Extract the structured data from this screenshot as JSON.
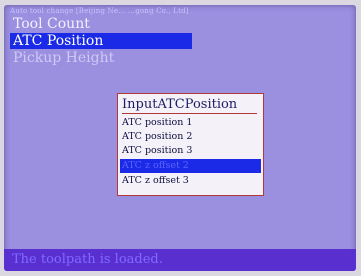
{
  "header": {
    "title": "Auto tool change [Beijing Ne... ...gong Co., Ltd]"
  },
  "menu": {
    "items": [
      {
        "label": "Tool Count",
        "selected": false
      },
      {
        "label": "ATC Position",
        "selected": true
      },
      {
        "label": "Pickup Height",
        "selected": false
      }
    ]
  },
  "popup": {
    "title": "InputATCPosition",
    "options": [
      {
        "label": "ATC position 1",
        "selected": false
      },
      {
        "label": "ATC position 2",
        "selected": false
      },
      {
        "label": "ATC position 3",
        "selected": false
      },
      {
        "label": "ATC z offset 2",
        "selected": true
      },
      {
        "label": "ATC z offset 3",
        "selected": false
      }
    ]
  },
  "status": {
    "message": "The toolpath is loaded."
  },
  "colors": {
    "screen_background": "#9b8fe0",
    "selection": "#1a2ae6",
    "status_bar": "#5a2fd0",
    "popup_border": "#b03a3a"
  }
}
